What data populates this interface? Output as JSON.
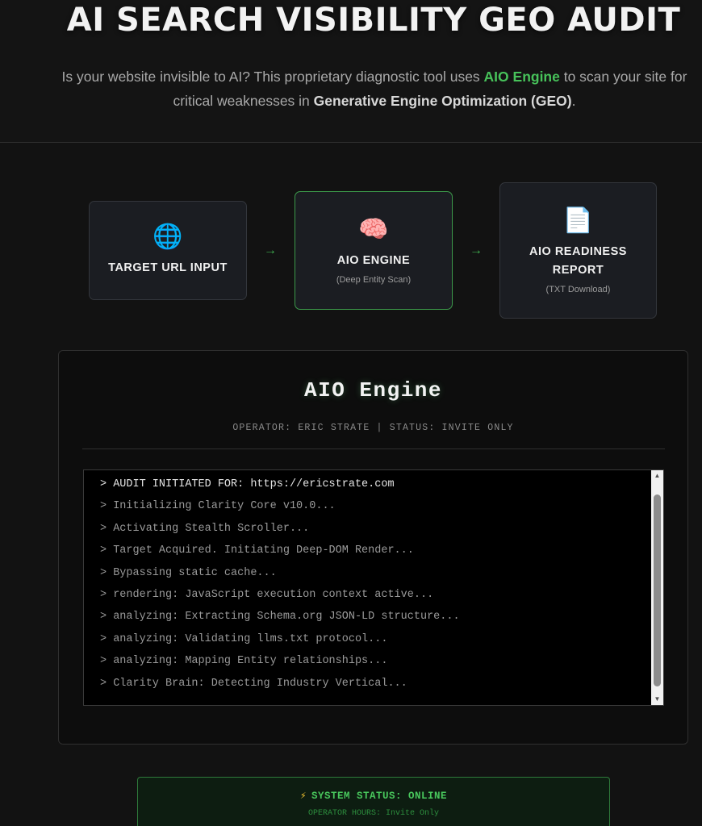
{
  "hero": {
    "title": "AI SEARCH VISIBILITY GEO AUDIT",
    "desc_part1": "Is your website invisible to AI? This proprietary diagnostic tool uses ",
    "desc_engine": "AIO Engine",
    "desc_part2": " to scan your site for critical weaknesses in ",
    "desc_geo": "Generative Engine Optimization (GEO)",
    "desc_part3": "."
  },
  "flow": {
    "steps": [
      {
        "icon": "globe-icon",
        "glyph": "🌐",
        "title": "TARGET URL INPUT",
        "subtitle": ""
      },
      {
        "icon": "brain-icon",
        "glyph": "🧠",
        "title": "AIO ENGINE",
        "subtitle": "(Deep Entity Scan)"
      },
      {
        "icon": "document-icon",
        "glyph": "📄",
        "title": "AIO READINESS REPORT",
        "subtitle": "(TXT Download)"
      }
    ],
    "arrow": "→"
  },
  "engine": {
    "title": "AIO Engine",
    "subtitle": "OPERATOR: ERIC STRATE | STATUS: INVITE ONLY",
    "log": [
      "> AUDIT INITIATED FOR: https://ericstrate.com",
      "> Initializing Clarity Core v10.0...",
      "> Activating Stealth Scroller...",
      "> Target Acquired. Initiating Deep-DOM Render...",
      "> Bypassing static cache...",
      "> rendering: JavaScript execution context active...",
      "> analyzing: Extracting Schema.org JSON-LD structure...",
      "> analyzing: Validating llms.txt protocol...",
      "> analyzing: Mapping Entity relationships...",
      "> Clarity Brain: Detecting Industry Vertical..."
    ]
  },
  "status": {
    "bolt": "⚡",
    "label": "SYSTEM STATUS: ONLINE",
    "hours": "OPERATOR HOURS: Invite Only"
  },
  "colors": {
    "background": "#121212",
    "accent_green": "#47c25a",
    "card_bg": "#1b1d22",
    "terminal_bg": "#000000"
  }
}
